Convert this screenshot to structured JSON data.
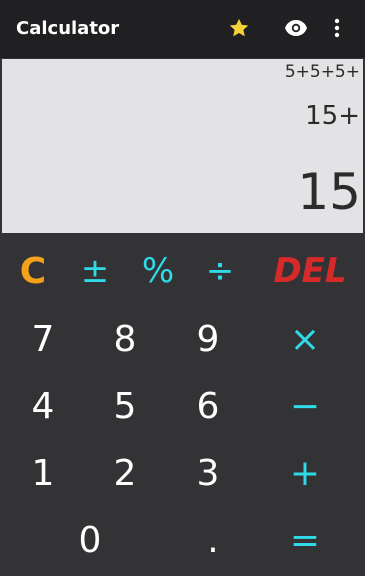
{
  "appbar": {
    "title": "Calculator",
    "icons": [
      "star-icon",
      "eye-icon",
      "more-vert-icon"
    ],
    "star_color": "#f4d23a"
  },
  "display": {
    "history": "5+5+5+",
    "expression": "15+",
    "result": "15",
    "background": "#e3e2e4"
  },
  "keys": {
    "clear": "C",
    "plus_minus": "±",
    "percent": "%",
    "divide": "÷",
    "delete": "DEL",
    "seven": "7",
    "eight": "8",
    "nine": "9",
    "multiply": "×",
    "four": "4",
    "five": "5",
    "six": "6",
    "minus": "−",
    "one": "1",
    "two": "2",
    "three": "3",
    "plus": "+",
    "zero": "0",
    "decimal": ".",
    "equals": "="
  },
  "colors": {
    "operator": "#2fd9e6",
    "clear": "#f5a21b",
    "delete": "#d62a2a",
    "keypad_bg": "#333335"
  }
}
